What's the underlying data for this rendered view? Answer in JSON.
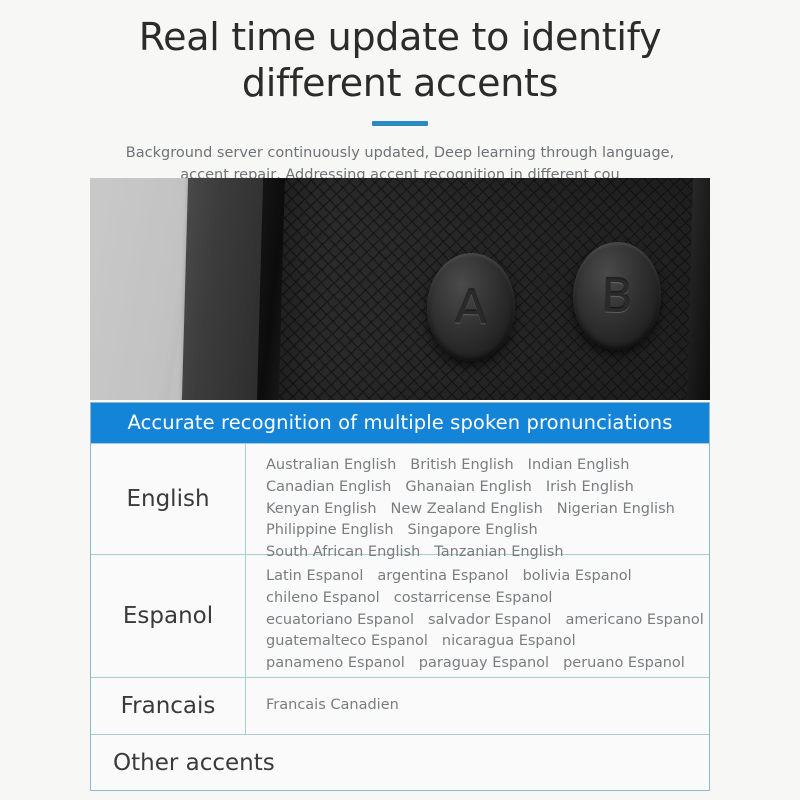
{
  "header": {
    "title_line1": "Real time update to identify",
    "title_line2": "different accents",
    "subtitle": "Background server continuously updated, Deep learning through language, accent repair, Addressing accent recognition in different cou"
  },
  "photo": {
    "alt": "Close-up of black translator device with textured surface",
    "button_a": "A",
    "button_b": "B"
  },
  "table": {
    "banner": "Accurate recognition of multiple spoken pronunciations",
    "rows": [
      {
        "language": "English",
        "lines": [
          [
            "Australian English",
            "British English",
            "Indian English"
          ],
          [
            "Canadian English",
            "Ghanaian English",
            "Irish English"
          ],
          [
            "Kenyan English",
            "New Zealand English",
            "Nigerian English"
          ],
          [
            "Philippine English",
            "Singapore English"
          ],
          [
            "South African English",
            "Tanzanian English"
          ]
        ]
      },
      {
        "language": "Espanol",
        "lines": [
          [
            "Latin Espanol",
            "argentina Espanol",
            "bolivia Espanol"
          ],
          [
            "chileno Espanol",
            "costarricense Espanol"
          ],
          [
            "ecuatoriano Espanol",
            "salvador Espanol",
            "americano Espanol"
          ],
          [
            "guatemalteco Espanol",
            "nicaragua Espanol"
          ],
          [
            "panameno Espanol",
            "paraguay Espanol",
            "peruano Espanol"
          ]
        ]
      },
      {
        "language": "Francais",
        "lines": [
          [
            "Francais Canadien"
          ]
        ]
      }
    ],
    "other_accents": "Other accents"
  },
  "colors": {
    "banner_blue": "#1484d8",
    "accent_bar": "#2a8bc4",
    "table_border": "#a9cdd8",
    "page_bg": "#f7f7f6",
    "title_text": "#2b2b2b",
    "body_text": "#7a7d80"
  }
}
